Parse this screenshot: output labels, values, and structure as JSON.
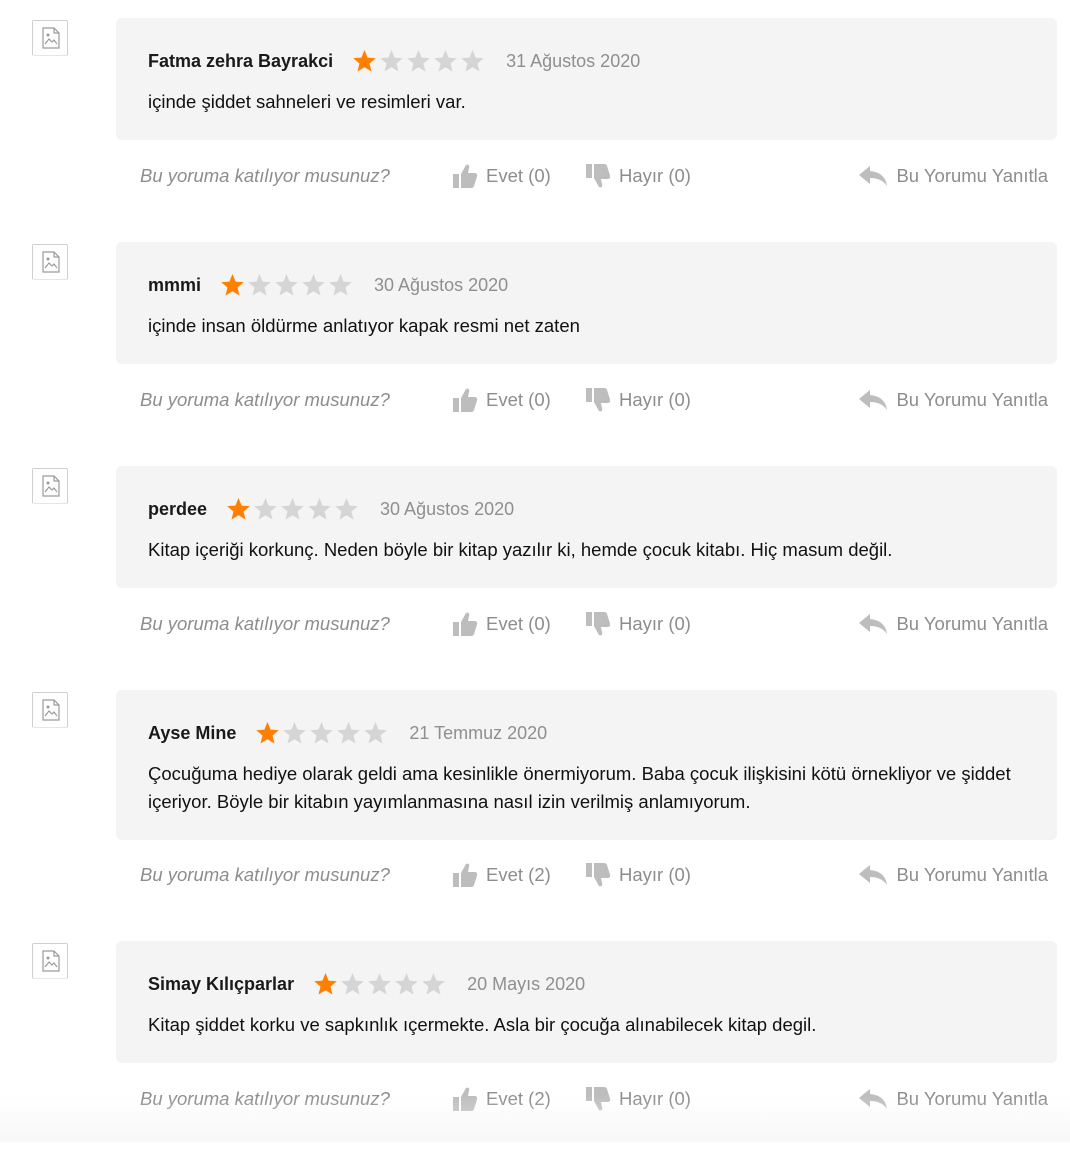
{
  "question": "Bu yoruma katılıyor musunuz?",
  "reply_label": "Bu Yorumu Yanıtla",
  "colors": {
    "star_filled": "#ff7f00",
    "star_empty": "#d5d5d5",
    "card_bg": "#f4f4f4"
  },
  "icons": {
    "avatar": "image-placeholder-icon",
    "like": "thumbs-up-icon",
    "dislike": "thumbs-down-icon",
    "reply": "reply-arrow-icon",
    "star": "star-icon"
  },
  "reviews": [
    {
      "author": "Fatma zehra Bayrakci",
      "rating": 1,
      "max_rating": 5,
      "date": "31 Ağustos 2020",
      "text": "içinde şiddet sahneleri ve resimleri var.",
      "yes_label": "Evet (0)",
      "no_label": "Hayır (0)"
    },
    {
      "author": "mmmi",
      "rating": 1,
      "max_rating": 5,
      "date": "30 Ağustos 2020",
      "text": "içinde insan öldürme anlatıyor kapak resmi net zaten",
      "yes_label": "Evet (0)",
      "no_label": "Hayır (0)"
    },
    {
      "author": "perdee",
      "rating": 1,
      "max_rating": 5,
      "date": "30 Ağustos 2020",
      "text": "Kitap içeriği korkunç. Neden böyle bir kitap yazılır ki, hemde çocuk kitabı. Hiç masum değil.",
      "yes_label": "Evet (0)",
      "no_label": "Hayır (0)"
    },
    {
      "author": "Ayse Mine",
      "rating": 1,
      "max_rating": 5,
      "date": "21 Temmuz 2020",
      "text": "Çocuğuma hediye olarak geldi ama kesinlikle önermiyorum. Baba çocuk ilişkisini kötü örnekliyor ve şiddet içeriyor. Böyle bir kitabın yayımlanmasına nasıl izin verilmiş anlamıyorum.",
      "yes_label": "Evet (2)",
      "no_label": "Hayır (0)"
    },
    {
      "author": "Simay Kılıçparlar",
      "rating": 1,
      "max_rating": 5,
      "date": "20 Mayıs 2020",
      "text": "Kitap şiddet korku ve sapkınlık ıçermekte. Asla bir çocuğa alınabilecek kitap degil.",
      "yes_label": "Evet (2)",
      "no_label": "Hayır (0)"
    }
  ]
}
